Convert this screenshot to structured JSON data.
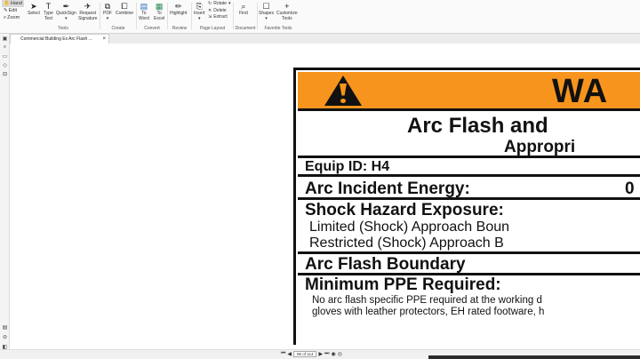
{
  "ribbon": {
    "modes": [
      {
        "label": "Hand",
        "active": true,
        "icon": "hand-icon"
      },
      {
        "label": "Edit",
        "active": false,
        "icon": "edit-icon"
      },
      {
        "label": "Zoom",
        "active": false,
        "icon": "zoom-icon"
      }
    ],
    "buttons": {
      "select": "Select",
      "type_text_1": "Type",
      "type_text_2": "Text",
      "quicksign_1": "QuickSign",
      "quicksign_2": "▾",
      "request_sig_1": "Request",
      "request_sig_2": "Signature",
      "pdf": "PDF",
      "combine": "Combine",
      "to_word_1": "To",
      "to_word_2": "Word",
      "to_excel_1": "To",
      "to_excel_2": "Excel",
      "highlight": "Highlight",
      "insert": "Insert",
      "rotate": "Rotate",
      "delete": "Delete",
      "extract": "Extract",
      "find": "Find",
      "shapes": "Shapes",
      "customize_1": "Customize",
      "customize_2": "Tools"
    },
    "groups": {
      "tools": "Tools",
      "create": "Create",
      "convert": "Convert",
      "review": "Review",
      "page_layout": "Page Layout",
      "document": "Document",
      "favorite_tools": "Favorite Tools"
    }
  },
  "tab": {
    "title": "Commercial Building Ex Arc Flash ...",
    "close": "×"
  },
  "sign": {
    "warning": "WA",
    "title": "Arc Flash and",
    "subtitle": "Appropri",
    "equip_id": "Equip ID: H4",
    "arc_energy": "Arc Incident Energy:",
    "arc_energy_value": "0",
    "shock_hazard": "Shock Hazard Exposure:",
    "limited": "Limited (Shock) Approach Boun",
    "restricted": "Restricted (Shock) Approach B",
    "arc_boundary": "Arc Flash Boundary",
    "min_ppe": "Minimum PPE Required:",
    "ppe_line1": "No arc flash specific PPE required at the working d",
    "ppe_line2": "gloves with leather protectors, EH rated footware, h"
  },
  "status": {
    "page_indicator": "96 of 114"
  },
  "colors": {
    "warning_orange": "#f7941d"
  }
}
